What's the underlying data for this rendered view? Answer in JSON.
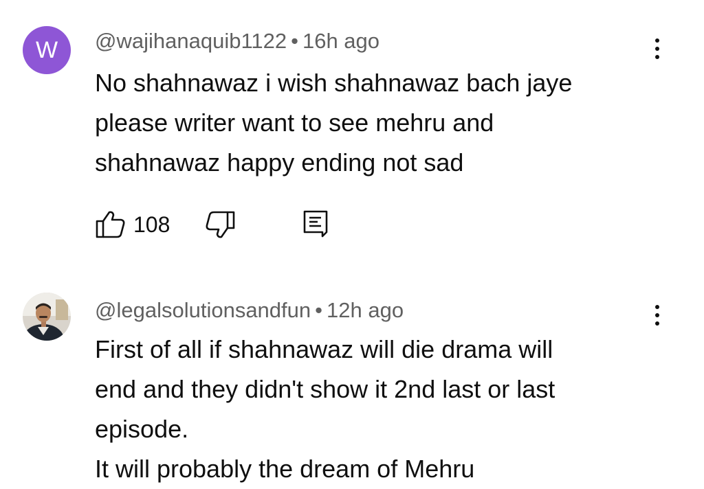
{
  "comments": [
    {
      "avatar_letter": "W",
      "avatar_color": "#8e56d6",
      "username": "@wajihanaquib1122",
      "separator": "•",
      "time": "16h ago",
      "text_lines": [
        "No shahnawaz i wish shahnawaz bach jaye",
        "please writer want to see mehru and",
        "shahnawaz happy ending not sad"
      ],
      "like_count": "108",
      "icons": {
        "like": "thumbs-up-icon",
        "dislike": "thumbs-down-icon",
        "reply": "reply-comment-icon",
        "menu": "more-vertical-icon"
      }
    },
    {
      "username": "@legalsolutionsandfun",
      "separator": "•",
      "time": "12h ago",
      "text_lines": [
        "First of all if shahnawaz will die drama will",
        "end and they didn't show it 2nd last or last",
        "episode.",
        "It will probably the dream of Mehru"
      ],
      "icons": {
        "avatar": "profile-photo",
        "menu": "more-vertical-icon"
      }
    }
  ],
  "colors": {
    "text_primary": "#0f0f0f",
    "text_secondary": "#606060",
    "background": "#ffffff"
  }
}
